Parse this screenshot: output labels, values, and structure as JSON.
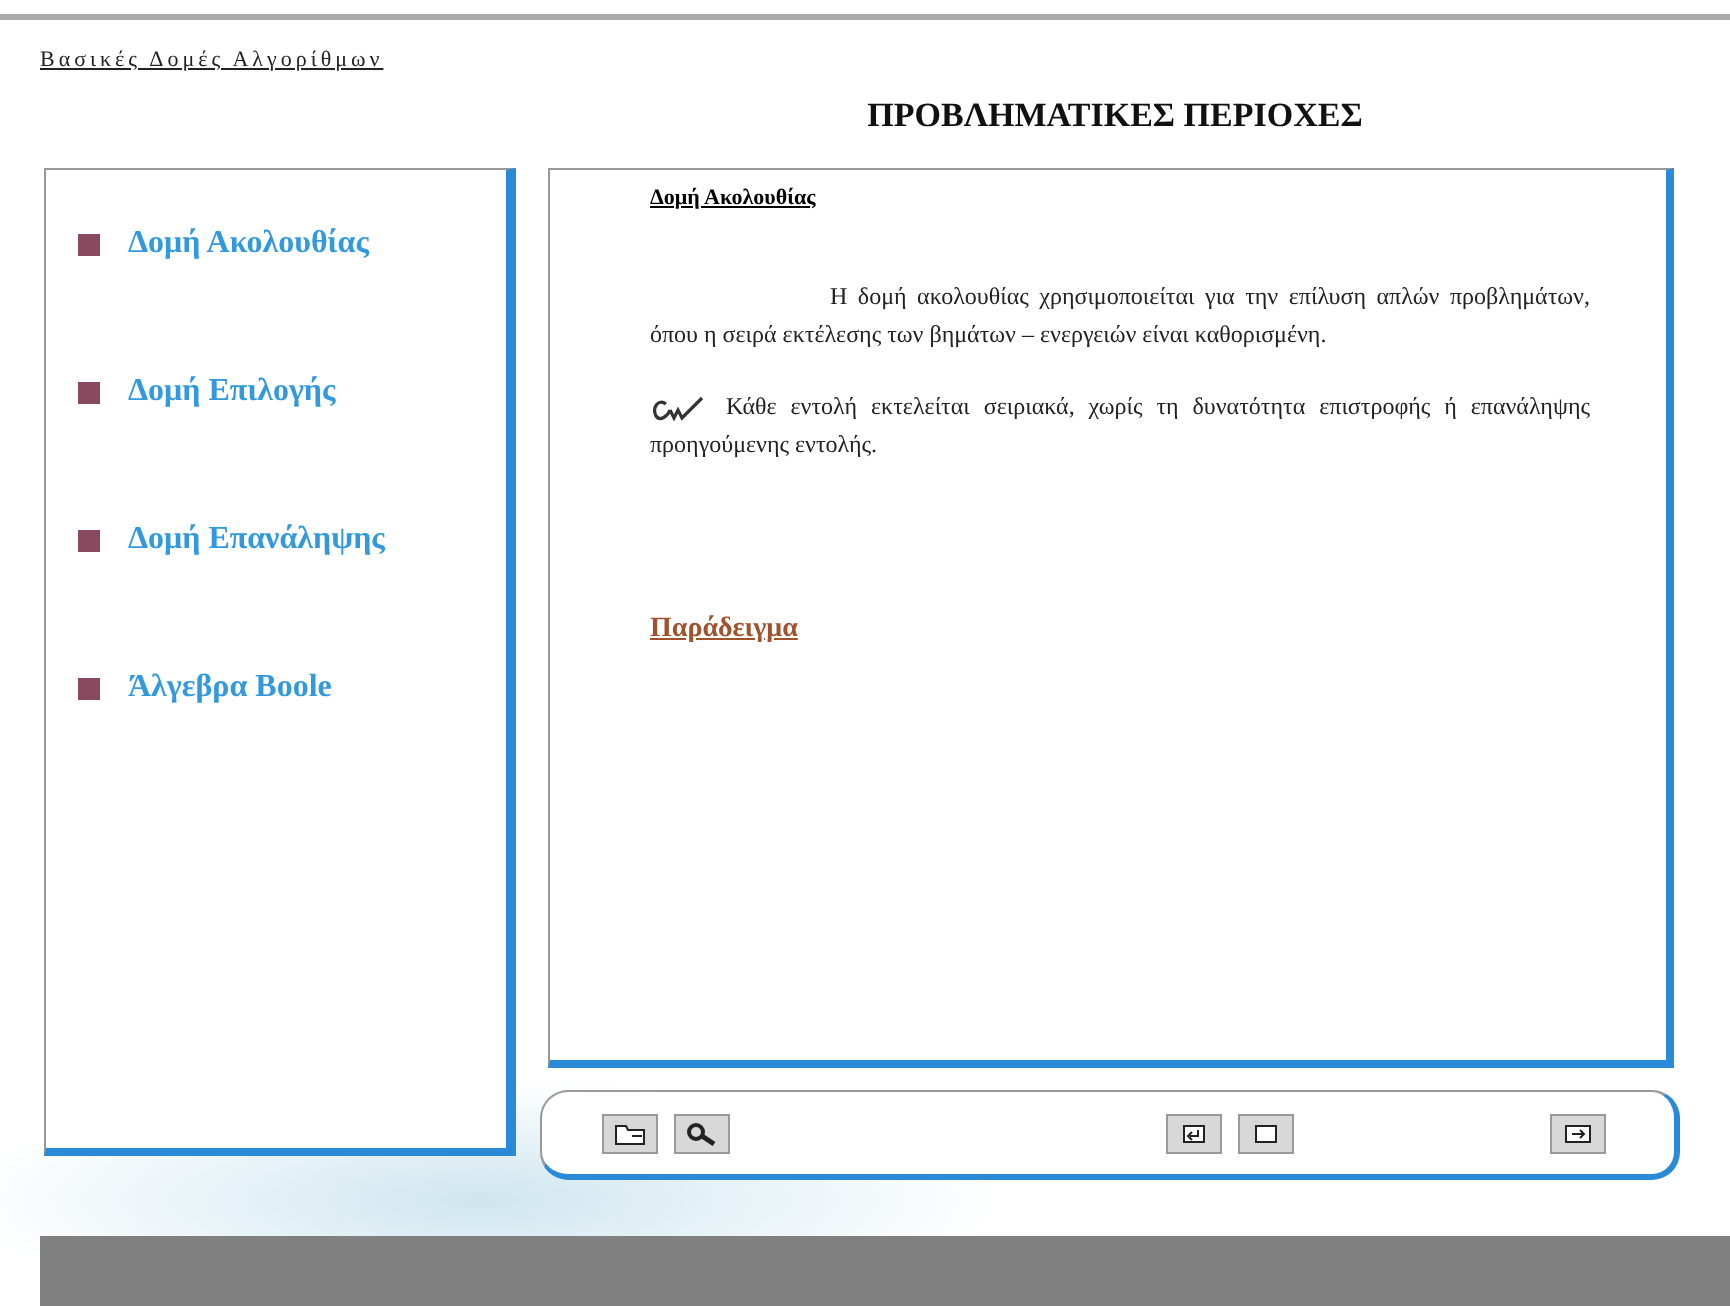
{
  "header": {
    "title": "Βασικές Δομές Αλγορίθμων",
    "heading": "ΠΡΟΒΛΗΜΑΤΙΚΕΣ ΠΕΡΙΟΧΕΣ"
  },
  "sidebar": {
    "items": [
      {
        "label": "Δομή Ακολουθίας"
      },
      {
        "label": "Δομή Επιλογής"
      },
      {
        "label": "Δομή Επανάληψης"
      },
      {
        "label": "Άλγεβρα Boole"
      }
    ]
  },
  "content": {
    "title": "Δομή Ακολουθίας",
    "paragraph": "Η δομή ακολουθίας χρησιμοποιείται για την επίλυση απλών προβλημάτων, όπου η σειρά εκτέλεσης των βημάτων – ενεργειών είναι καθορισμένη.",
    "note": "Κάθε εντολή εκτελείται σειριακά, χωρίς τη δυνατότητα επιστροφής ή επανάληψης προηγούμενης εντολής.",
    "link": "Παράδειγμα"
  },
  "toolbar": {
    "buttons": [
      {
        "kind": "folder"
      },
      {
        "kind": "search"
      },
      {
        "kind": "back"
      },
      {
        "kind": "stop"
      },
      {
        "kind": "next"
      }
    ]
  }
}
